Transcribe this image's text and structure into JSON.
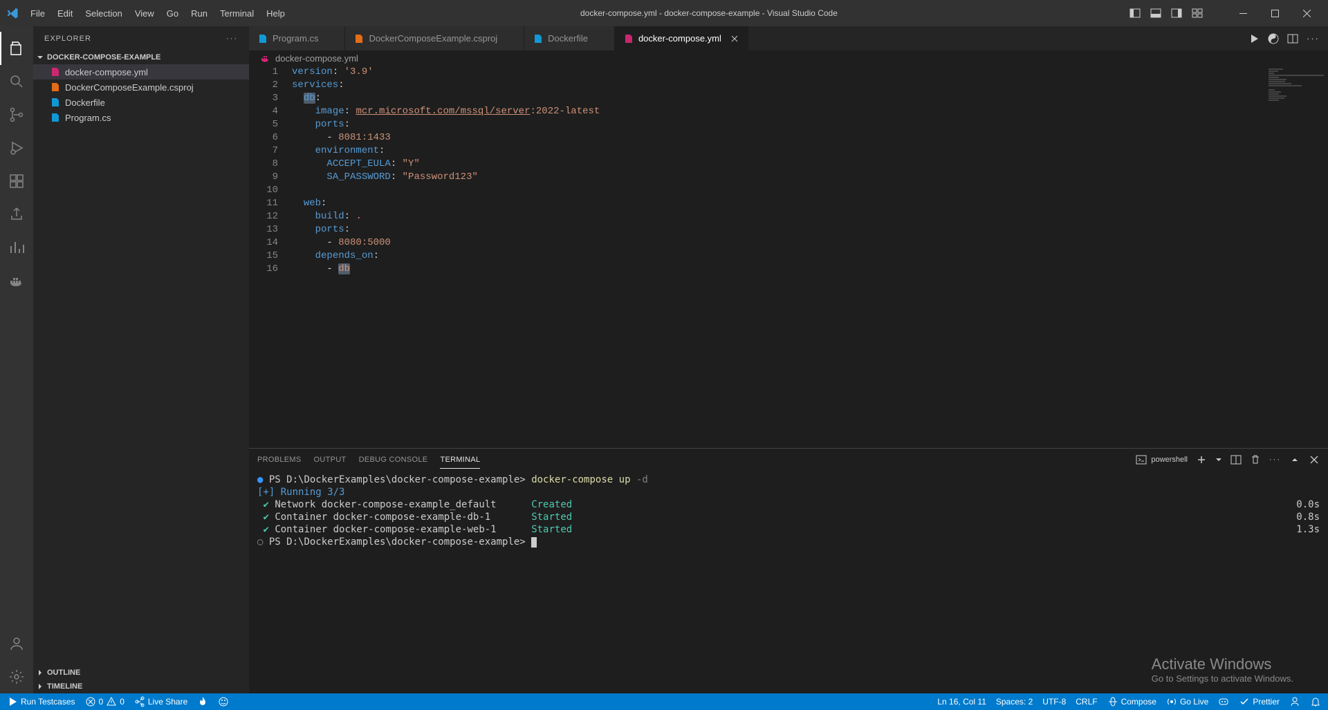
{
  "window": {
    "title": "docker-compose.yml - docker-compose-example - Visual Studio Code"
  },
  "menu": [
    "File",
    "Edit",
    "Selection",
    "View",
    "Go",
    "Run",
    "Terminal",
    "Help"
  ],
  "sidebar": {
    "title": "EXPLORER",
    "project": "DOCKER-COMPOSE-EXAMPLE",
    "files": [
      {
        "name": "docker-compose.yml",
        "selected": true,
        "iconColor": "#db2777"
      },
      {
        "name": "DockerComposeExample.csproj",
        "selected": false,
        "iconColor": "#f97316"
      },
      {
        "name": "Dockerfile",
        "selected": false,
        "iconColor": "#0ea5e9"
      },
      {
        "name": "Program.cs",
        "selected": false,
        "iconColor": "#0ea5e9"
      }
    ],
    "outline": "OUTLINE",
    "timeline": "TIMELINE"
  },
  "tabs": [
    {
      "label": "Program.cs",
      "active": false,
      "iconColor": "#0ea5e9"
    },
    {
      "label": "DockerComposeExample.csproj",
      "active": false,
      "iconColor": "#f97316"
    },
    {
      "label": "Dockerfile",
      "active": false,
      "iconColor": "#0ea5e9"
    },
    {
      "label": "docker-compose.yml",
      "active": true,
      "iconColor": "#db2777"
    }
  ],
  "breadcrumb": {
    "file": "docker-compose.yml"
  },
  "code": {
    "lines": [
      [
        {
          "t": "version",
          "c": "key"
        },
        {
          "t": ": ",
          "c": "punc"
        },
        {
          "t": "'3.9'",
          "c": "str"
        }
      ],
      [
        {
          "t": "services",
          "c": "key"
        },
        {
          "t": ":",
          "c": "punc"
        }
      ],
      [
        {
          "t": "  ",
          "c": "punc"
        },
        {
          "t": "db",
          "c": "key",
          "hl": true
        },
        {
          "t": ":",
          "c": "punc"
        }
      ],
      [
        {
          "t": "    ",
          "c": "punc"
        },
        {
          "t": "image",
          "c": "key"
        },
        {
          "t": ": ",
          "c": "punc"
        },
        {
          "t": "mcr.microsoft.com/mssql/server",
          "c": "link"
        },
        {
          "t": ":2022-latest",
          "c": "str"
        }
      ],
      [
        {
          "t": "    ",
          "c": "punc"
        },
        {
          "t": "ports",
          "c": "key"
        },
        {
          "t": ":",
          "c": "punc"
        }
      ],
      [
        {
          "t": "      - ",
          "c": "punc"
        },
        {
          "t": "8081:1433",
          "c": "str"
        }
      ],
      [
        {
          "t": "    ",
          "c": "punc"
        },
        {
          "t": "environment",
          "c": "key"
        },
        {
          "t": ":",
          "c": "punc"
        }
      ],
      [
        {
          "t": "      ",
          "c": "punc"
        },
        {
          "t": "ACCEPT_EULA",
          "c": "key"
        },
        {
          "t": ": ",
          "c": "punc"
        },
        {
          "t": "\"Y\"",
          "c": "str"
        }
      ],
      [
        {
          "t": "      ",
          "c": "punc"
        },
        {
          "t": "SA_PASSWORD",
          "c": "key"
        },
        {
          "t": ": ",
          "c": "punc"
        },
        {
          "t": "\"Password123\"",
          "c": "str"
        }
      ],
      [],
      [
        {
          "t": "  ",
          "c": "punc"
        },
        {
          "t": "web",
          "c": "key"
        },
        {
          "t": ":",
          "c": "punc"
        }
      ],
      [
        {
          "t": "    ",
          "c": "punc"
        },
        {
          "t": "build",
          "c": "key"
        },
        {
          "t": ": ",
          "c": "punc"
        },
        {
          "t": ".",
          "c": "str"
        }
      ],
      [
        {
          "t": "    ",
          "c": "punc"
        },
        {
          "t": "ports",
          "c": "key"
        },
        {
          "t": ":",
          "c": "punc"
        }
      ],
      [
        {
          "t": "      - ",
          "c": "punc"
        },
        {
          "t": "8080:5000",
          "c": "str"
        }
      ],
      [
        {
          "t": "    ",
          "c": "punc"
        },
        {
          "t": "depends_on",
          "c": "key"
        },
        {
          "t": ":",
          "c": "punc"
        }
      ],
      [
        {
          "t": "      - ",
          "c": "punc"
        },
        {
          "t": "db",
          "c": "str",
          "hl": true
        }
      ]
    ]
  },
  "panel": {
    "tabs": [
      "PROBLEMS",
      "OUTPUT",
      "DEBUG CONSOLE",
      "TERMINAL"
    ],
    "activeTab": "TERMINAL",
    "shellLabel": "powershell",
    "terminal": {
      "promptPath": "PS D:\\DockerExamples\\docker-compose-example>",
      "cmd1": "docker-compose",
      "cmd2": "up",
      "cmd3": "-d",
      "running": "[+] Running 3/3",
      "rows": [
        {
          "text": "Network docker-compose-example_default",
          "status": "Created",
          "time": "0.0s"
        },
        {
          "text": "Container docker-compose-example-db-1",
          "status": "Started",
          "time": "0.8s"
        },
        {
          "text": "Container docker-compose-example-web-1",
          "status": "Started",
          "time": "1.3s"
        }
      ]
    }
  },
  "status": {
    "runTestcases": "Run Testcases",
    "errors": "0",
    "warnings": "0",
    "liveShare": "Live Share",
    "cursor": "Ln 16, Col 11",
    "spaces": "Spaces: 2",
    "encoding": "UTF-8",
    "eol": "CRLF",
    "lang": "Compose",
    "goLive": "Go Live",
    "prettier": "Prettier"
  },
  "watermark": {
    "heading": "Activate Windows",
    "sub": "Go to Settings to activate Windows."
  }
}
